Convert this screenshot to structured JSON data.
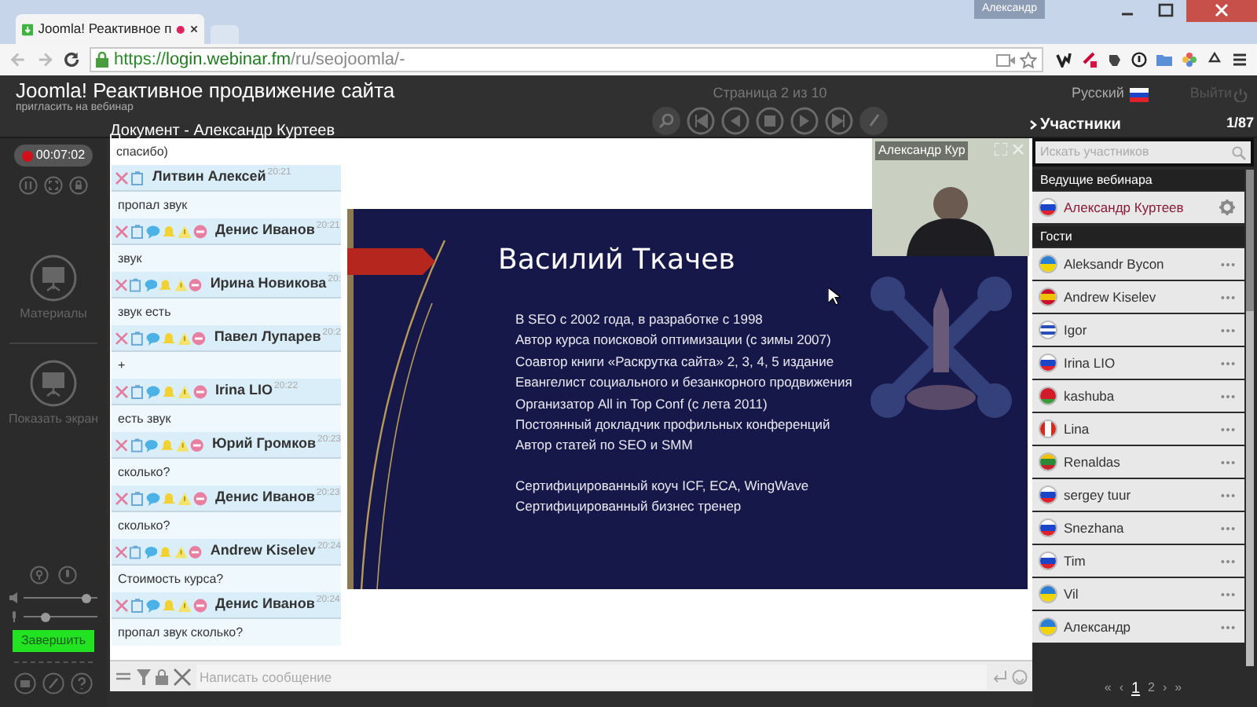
{
  "browser": {
    "tab": {
      "title": "Joomla! Реактивное п",
      "recording": true
    },
    "user_button": "Александр",
    "url": {
      "scheme": "https://",
      "host": "login.webinar.fm",
      "path": "/ru/seojoomla/-"
    }
  },
  "header": {
    "title": "Joomla! Реактивное продвижение сайта",
    "subtitle": "пригласить на вебинар",
    "document_label": "Документ - Александр Куртеев",
    "page_indicator": "Страница 2 из 10",
    "language": "Русский",
    "exit": "Выйти"
  },
  "left_panel": {
    "timer": "00:07:02",
    "tools": [
      {
        "label": "Материалы"
      },
      {
        "label": "Показать экран"
      }
    ],
    "volume": {
      "level": 0.85
    },
    "mic": {
      "level": 0.3
    },
    "finish_button": "Завершить"
  },
  "chat": {
    "messages": [
      {
        "text": "спасибо)"
      },
      {
        "name": "Литвин Алексей",
        "time": "20:21",
        "text": "пропал звук",
        "kind": "short"
      },
      {
        "name": "Денис Иванов",
        "time": "20:21",
        "text": "звук",
        "kind": "full"
      },
      {
        "name": "Ирина Новикова",
        "time": "20:",
        "text": "звук есть",
        "kind": "full"
      },
      {
        "name": "Павел Лупарев",
        "time": "20:2",
        "text": "+",
        "kind": "full"
      },
      {
        "name": "Irina LIO",
        "time": "20:22",
        "text": "есть звук",
        "kind": "full"
      },
      {
        "name": "Юрий Громков",
        "time": "20:23",
        "text": "сколько?",
        "kind": "full"
      },
      {
        "name": "Денис Иванов",
        "time": "20:23",
        "text": "сколько?",
        "kind": "full"
      },
      {
        "name": "Andrew Kiselev",
        "time": "20:24",
        "text": "Стоимость курса?",
        "kind": "full"
      },
      {
        "name": "Денис Иванов",
        "time": "20:24",
        "text": "пропал звук сколько?",
        "kind": "full"
      }
    ],
    "placeholder": "Написать сообщение"
  },
  "slide": {
    "title": "Василий Ткачев",
    "bullet_groups": [
      [
        "В SEO с 2002 года, в разработке с 1998",
        "Автор курса поисковой оптимизации (с зимы 2007)",
        "Соавтор книги «Раскрутка сайта» 2, 3, 4, 5 издание",
        "Евангелист социального и безанкорного продвижения",
        "Организатор All in Top Conf (с лета 2011)",
        "Постоянный докладчик профильных конференций",
        "Автор статей по SEO и SMM"
      ],
      [
        "Сертифицированный коуч ICF, ECA, WingWave",
        "Сертифицированный бизнес тренер"
      ]
    ]
  },
  "video": {
    "label": "Александр Кур"
  },
  "participants": {
    "title": "Участники",
    "count": "1/87",
    "search_placeholder": "Искать участников",
    "hosts_heading": "Ведущие вебинара",
    "hosts": [
      {
        "name": "Александр Куртеев",
        "kind": "ru"
      }
    ],
    "guests_heading": "Гости",
    "guests": [
      {
        "name": "Aleksandr Bycon",
        "kind": "ua"
      },
      {
        "name": "Andrew Kiselev",
        "kind": "es"
      },
      {
        "name": "Igor",
        "kind": "il"
      },
      {
        "name": "Irina LIO",
        "kind": "ru"
      },
      {
        "name": "kashuba",
        "kind": "by"
      },
      {
        "name": "Lina",
        "kind": "ca"
      },
      {
        "name": "Renaldas",
        "kind": "lt"
      },
      {
        "name": "sergey tuur",
        "kind": "ru"
      },
      {
        "name": "Snezhana",
        "kind": "ru"
      },
      {
        "name": "Tim",
        "kind": "ru"
      },
      {
        "name": "Vil",
        "kind": "ua"
      },
      {
        "name": "Александр",
        "kind": "ua"
      }
    ],
    "pagination": [
      {
        "label": "«",
        "selected": false
      },
      {
        "label": "‹",
        "selected": false
      },
      {
        "label": "1",
        "selected": true
      },
      {
        "label": "2",
        "selected": false
      },
      {
        "label": "›",
        "selected": false
      },
      {
        "label": "»",
        "selected": false
      }
    ]
  }
}
